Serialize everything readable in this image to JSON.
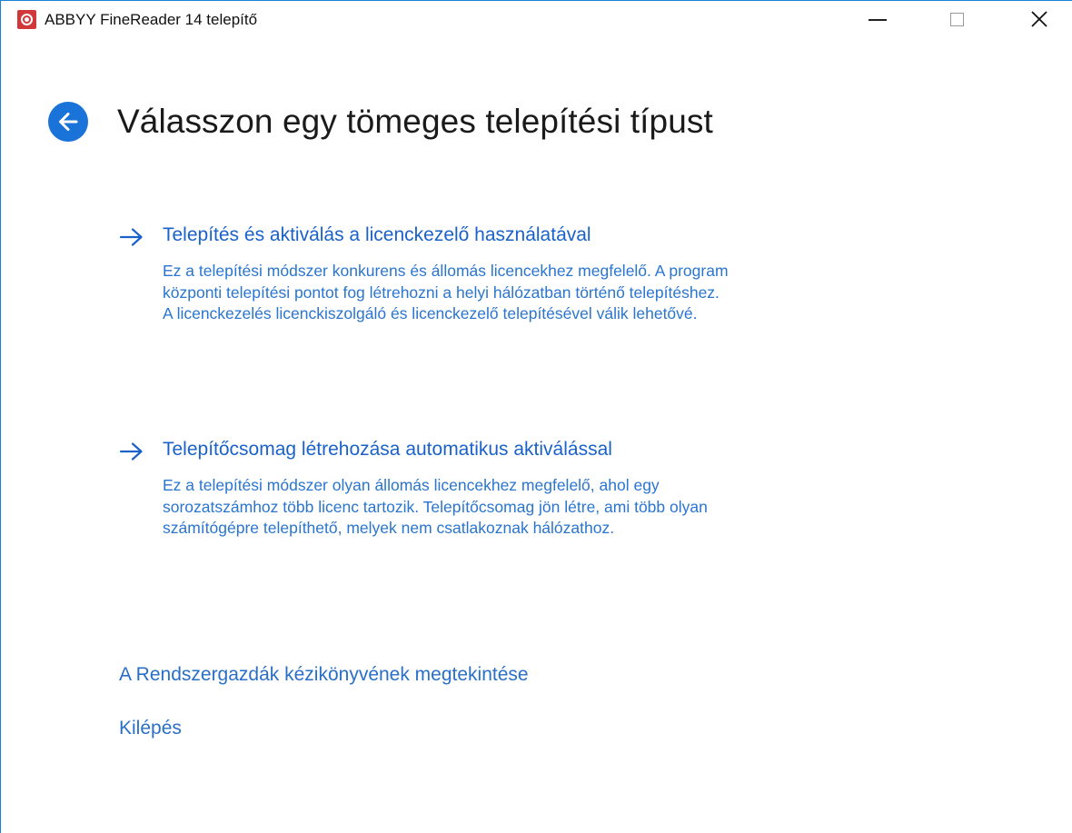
{
  "window": {
    "title": "ABBYY FineReader 14 telepítő",
    "accent_color": "#1a73d9",
    "logo_color": "#d0383a",
    "controls": {
      "minimize_icon": "minimize-icon",
      "maximize_icon": "maximize-icon",
      "close_icon": "close-icon"
    }
  },
  "header": {
    "back_icon": "arrow-left-circle-icon",
    "title": "Válasszon egy tömeges telepítési típust"
  },
  "options": [
    {
      "icon": "arrow-right-icon",
      "label": "Telepítés és aktiválás a licenckezelő használatával",
      "description": [
        "Ez a telepítési módszer konkurens és állomás licencekhez megfelelő. A program",
        "központi telepítési pontot fog létrehozni a helyi hálózatban történő telepítéshez.",
        "A licenckezelés licenckiszolgáló és licenckezelő telepítésével válik lehetővé."
      ]
    },
    {
      "icon": "arrow-right-icon",
      "label": "Telepítőcsomag létrehozása automatikus aktiválással",
      "description": [
        "Ez a telepítési módszer olyan állomás licencekhez megfelelő, ahol egy",
        "sorozatszámhoz több licenc tartozik. Telepítőcsomag jön létre, ami több olyan",
        "számítógépre telepíthető, melyek nem csatlakoznak hálózathoz."
      ]
    }
  ],
  "links": {
    "admin_guide": "A Rendszergazdák kézikönyvének megtekintése",
    "exit": "Kilépés"
  }
}
